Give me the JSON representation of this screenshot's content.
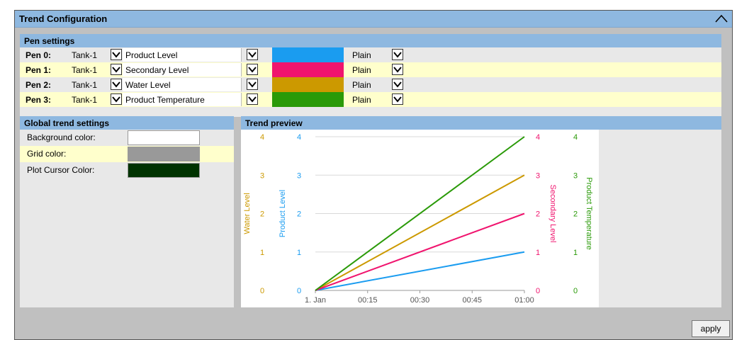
{
  "window": {
    "title": "Trend Configuration"
  },
  "pen_settings": {
    "title": "Pen settings",
    "pens": [
      {
        "label": "Pen 0:",
        "source": "Tank-1",
        "tag": "Product Level",
        "color": "#1a9cf0",
        "style": "Plain",
        "row_bg": "std"
      },
      {
        "label": "Pen 1:",
        "source": "Tank-1",
        "tag": "Secondary Level",
        "color": "#f0146e",
        "style": "Plain",
        "row_bg": "alt"
      },
      {
        "label": "Pen 2:",
        "source": "Tank-1",
        "tag": "Water Level",
        "color": "#cc9900",
        "style": "Plain",
        "row_bg": "std"
      },
      {
        "label": "Pen 3:",
        "source": "Tank-1",
        "tag": "Product Temperature",
        "color": "#2a9a08",
        "style": "Plain",
        "row_bg": "alt"
      }
    ]
  },
  "global_settings": {
    "title": "Global trend settings",
    "items": [
      {
        "label": "Background color:",
        "color": "#ffffff"
      },
      {
        "label": "Grid color:",
        "color": "#999999"
      },
      {
        "label": "Plot Cursor Color:",
        "color": "#003300"
      }
    ]
  },
  "trend_preview": {
    "title": "Trend preview"
  },
  "chart_data": {
    "type": "line",
    "x": [
      "1. Jan",
      "00:15",
      "00:30",
      "00:45",
      "01:00"
    ],
    "series": [
      {
        "name": "Product Level",
        "color": "#1a9cf0",
        "axis": "left-inner",
        "values": [
          0,
          1
        ]
      },
      {
        "name": "Water Level",
        "color": "#cc9900",
        "axis": "left-outer",
        "values": [
          0,
          3
        ]
      },
      {
        "name": "Secondary Level",
        "color": "#f0146e",
        "axis": "right-inner",
        "values": [
          0,
          2
        ]
      },
      {
        "name": "Product Temperature",
        "color": "#2a9a08",
        "axis": "right-outer",
        "values": [
          0,
          4
        ]
      }
    ],
    "y_ticks": [
      0,
      1,
      2,
      3,
      4
    ],
    "ylim": [
      0,
      4
    ],
    "grid": "horizontal"
  },
  "apply": {
    "label": "apply"
  }
}
